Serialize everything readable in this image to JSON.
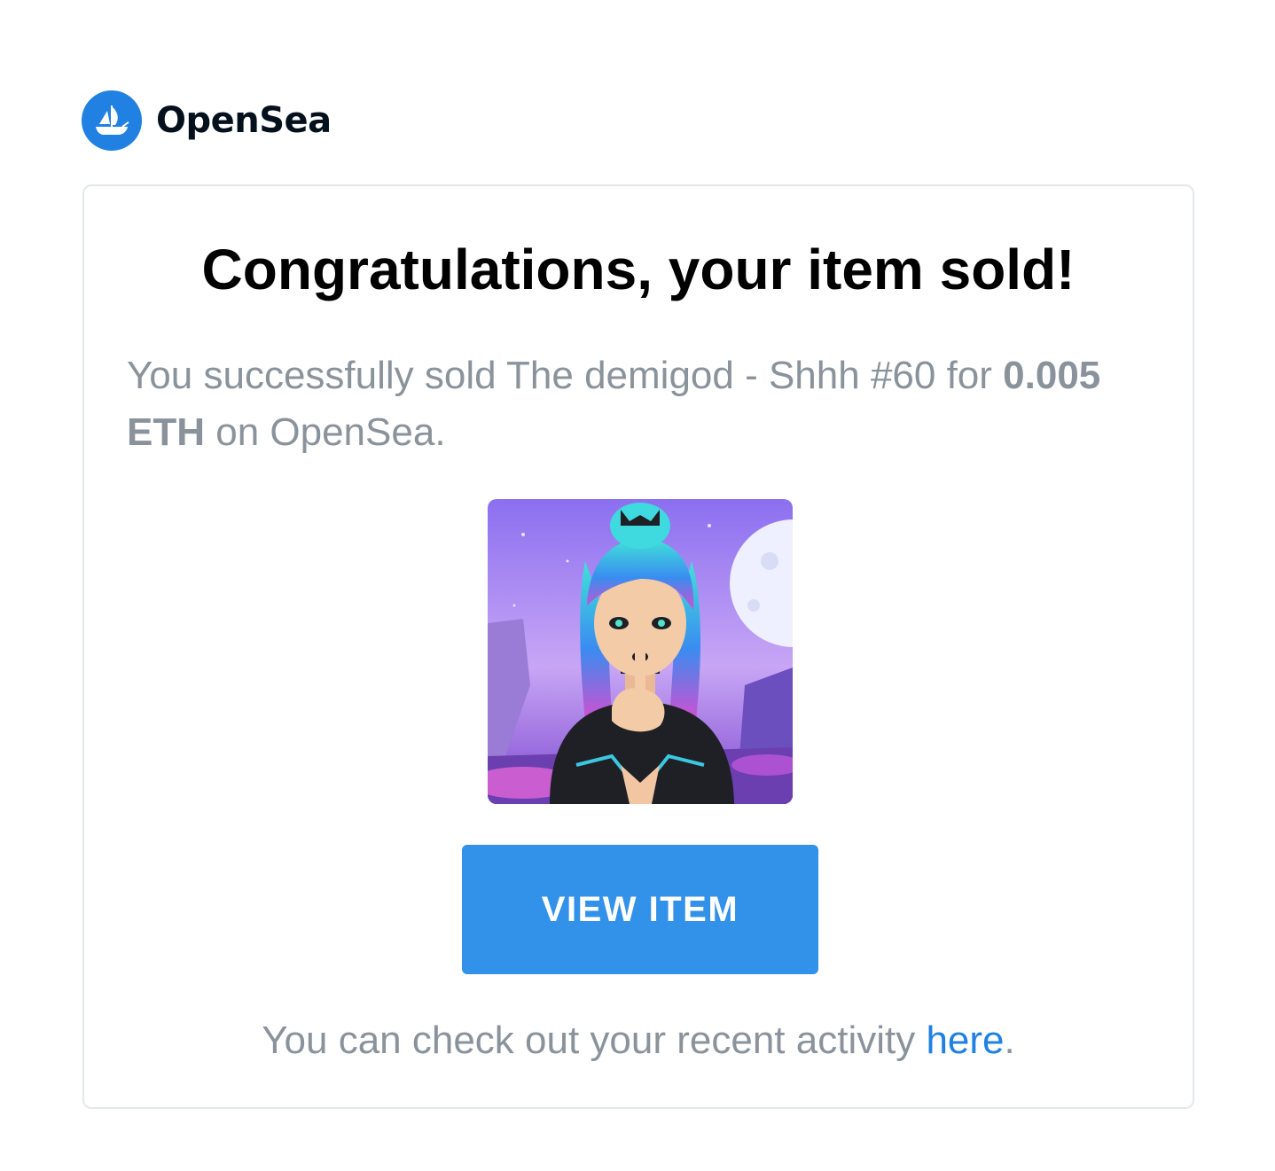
{
  "brand": {
    "name": "OpenSea",
    "logo_icon": "opensea-ship-logo",
    "color": "#2081e2"
  },
  "email": {
    "title": "Congratulations, your item sold!",
    "message_prefix": "You successfully sold The demigod - Shhh #60 for ",
    "price": "0.005 ETH",
    "message_suffix": " on OpenSea.",
    "item_image": {
      "icon": "nft-artwork-image",
      "description_colors": [
        "#9b7ff0",
        "#4fd6e6",
        "#c35ad6",
        "#1f1f26"
      ]
    },
    "button_label": "VIEW ITEM",
    "button_color": "#3291e9",
    "footer_prefix": "You can check out your recent activity ",
    "footer_link": "here",
    "footer_suffix": "."
  }
}
